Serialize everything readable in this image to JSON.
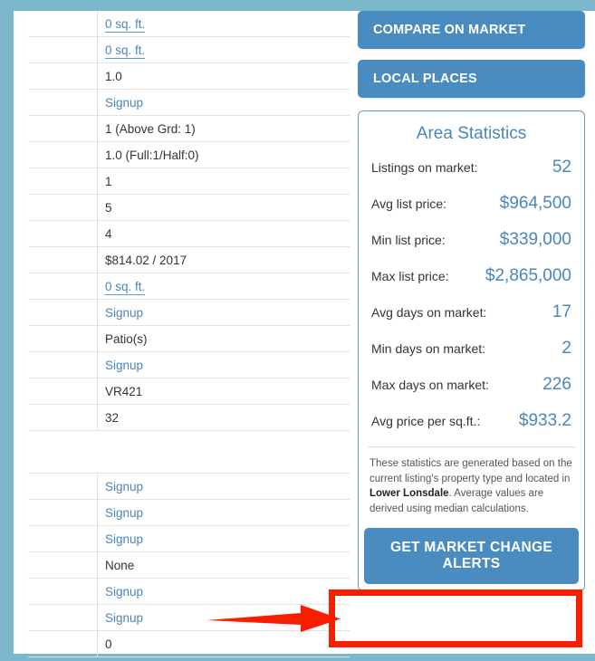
{
  "theme": {
    "frame_color": "#7bb8cb",
    "accent_blue": "#4a8cbf",
    "link_blue": "#4a86b8",
    "annotation_red": "#f91e00"
  },
  "details_table": {
    "rows": [
      {
        "value": "0 sq. ft.",
        "type": "link-underline"
      },
      {
        "value": "0 sq. ft.",
        "type": "link-underline"
      },
      {
        "value": "1.0",
        "type": "text"
      },
      {
        "value": "Signup",
        "type": "link"
      },
      {
        "value": "1 (Above Grd: 1)",
        "type": "text"
      },
      {
        "value": "1.0 (Full:1/Half:0)",
        "type": "text"
      },
      {
        "value": "1",
        "type": "text"
      },
      {
        "value": "5",
        "type": "text"
      },
      {
        "value": "4",
        "type": "text"
      },
      {
        "value": "$814.02 / 2017",
        "type": "text"
      },
      {
        "value": "0 sq. ft.",
        "type": "link-underline"
      },
      {
        "value": "Signup",
        "type": "link"
      },
      {
        "value": "Patio(s)",
        "type": "text"
      },
      {
        "value": "Signup",
        "type": "link"
      },
      {
        "value": "VR421",
        "type": "text"
      },
      {
        "value": "32",
        "type": "text"
      },
      {
        "value": "",
        "type": "gap"
      },
      {
        "value": "Signup",
        "type": "link"
      },
      {
        "value": "Signup",
        "type": "link"
      },
      {
        "value": "Signup",
        "type": "link"
      },
      {
        "value": "None",
        "type": "text"
      },
      {
        "value": "Signup",
        "type": "link"
      },
      {
        "value": "Signup",
        "type": "link"
      },
      {
        "value": "0",
        "type": "text"
      }
    ]
  },
  "sidebar": {
    "buttons": [
      {
        "label": "COMPARE ON MARKET"
      },
      {
        "label": "LOCAL PLACES"
      }
    ],
    "area_statistics": {
      "title": "Area Statistics",
      "stats": [
        {
          "label": "Listings on market:",
          "value": "52"
        },
        {
          "label": "Avg list price:",
          "value": "$964,500"
        },
        {
          "label": "Min list price:",
          "value": "$339,000"
        },
        {
          "label": "Max list price:",
          "value": "$2,865,000"
        },
        {
          "label": "Avg days on market:",
          "value": "17"
        },
        {
          "label": "Min days on market:",
          "value": "2"
        },
        {
          "label": "Max days on market:",
          "value": "226"
        },
        {
          "label": "Avg price per sq.ft.:",
          "value": "$933.2"
        }
      ],
      "note": {
        "part1": "These statistics are generated based on the current listing's property type and located in ",
        "area_name": "Lower Lonsdale",
        "part2": ". Average values are derived using median calculations."
      },
      "alerts_button_label": "GET MARKET CHANGE ALERTS"
    }
  }
}
